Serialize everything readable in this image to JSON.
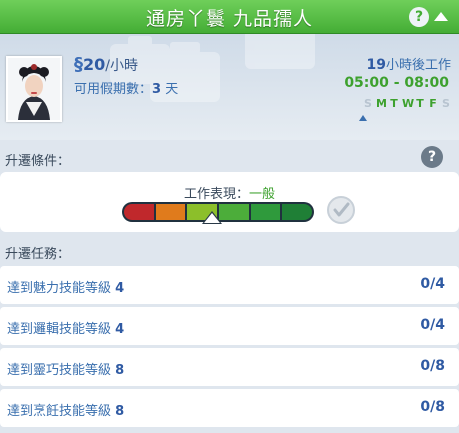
{
  "header": {
    "title": "通房丫鬟 九品孺人",
    "help": "?",
    "collapse_icon": "chevron-up-icon",
    "color": "#52b840"
  },
  "job": {
    "pay_symbol": "§",
    "pay_value": "20",
    "pay_unit": "/小時",
    "vacation_label": "可用假期數：",
    "vacation_days": "3",
    "vacation_unit": " 天",
    "next_work_hours": "19",
    "next_work_suffix": "小時後工作",
    "schedule": "05:00 - 08:00",
    "days": [
      {
        "letter": "S",
        "work": false
      },
      {
        "letter": "M",
        "work": true
      },
      {
        "letter": "T",
        "work": true
      },
      {
        "letter": "W",
        "work": true
      },
      {
        "letter": "T",
        "work": true
      },
      {
        "letter": "F",
        "work": true
      },
      {
        "letter": "S",
        "work": false
      }
    ]
  },
  "requirements": {
    "label": "升遷條件：",
    "help": "?",
    "performance_label": "工作表現：",
    "performance_value": "一般",
    "performance_level": 0.47,
    "bar_colors": [
      "#c0282c",
      "#e07b1c",
      "#8cbf2a",
      "#4cad3a",
      "#2f9a3c",
      "#1f7f36"
    ],
    "check_icon": "check-icon"
  },
  "tasks": {
    "label": "升遷任務：",
    "items": [
      {
        "prefix": "達到魅力技能等級 ",
        "level": "4",
        "progress": "0/4"
      },
      {
        "prefix": "達到邏輯技能等級 ",
        "level": "4",
        "progress": "0/4"
      },
      {
        "prefix": "達到靈巧技能等級 ",
        "level": "8",
        "progress": "0/8"
      },
      {
        "prefix": "達到烹飪技能等級 ",
        "level": "8",
        "progress": "0/8"
      }
    ]
  }
}
